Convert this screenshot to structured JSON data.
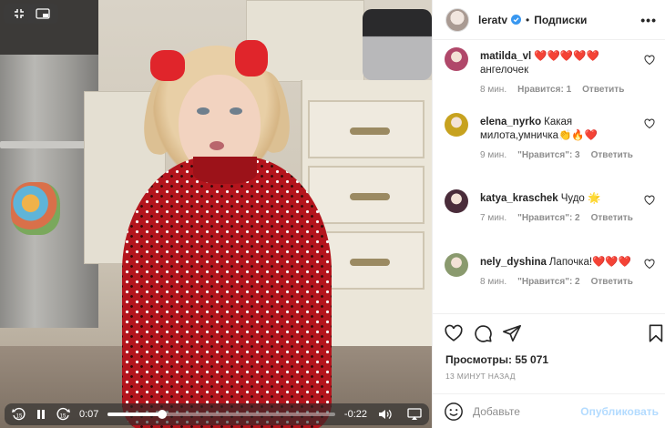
{
  "video": {
    "current_time": "0:07",
    "remaining_time": "-0:22",
    "progress": 0.24,
    "rewind_label": "15",
    "forward_label": "15"
  },
  "header": {
    "username": "leratv",
    "separator": "•",
    "follow_label": "Подписки",
    "more_label": "•••"
  },
  "comments": [
    {
      "user": "matilda_vl",
      "text": "❤️❤️❤️❤️❤️ ангелочек",
      "time": "8 мин.",
      "likes": "Нравится: 1",
      "reply": "Ответить",
      "avatar_color": "#b0486a"
    },
    {
      "user": "elena_nyrko",
      "text": "Какая милота,умничка👏🔥❤️",
      "time": "9 мин.",
      "likes": "\"Нравится\": 3",
      "reply": "Ответить",
      "avatar_color": "#c7a21f"
    },
    {
      "user": "katya_kraschek",
      "text": "Чудо 🌟",
      "time": "7 мин.",
      "likes": "\"Нравится\": 2",
      "reply": "Ответить",
      "avatar_color": "#4a2c3a"
    },
    {
      "user": "nely_dyshina",
      "text": "Лапочка!❤️❤️❤️",
      "time": "8 мин.",
      "likes": "\"Нравится\": 2",
      "reply": "Ответить",
      "avatar_color": "#8a9a6e"
    }
  ],
  "stats": {
    "views": "Просмотры: 55 071",
    "posted_ago": "13 МИНУТ НАЗАД"
  },
  "composer": {
    "placeholder": "Добавьте",
    "post_label": "Опубликовать"
  },
  "colors": {
    "verified": "#3897f0",
    "post_disabled": "#b3dbff",
    "meta_gray": "#8e8e8e"
  }
}
